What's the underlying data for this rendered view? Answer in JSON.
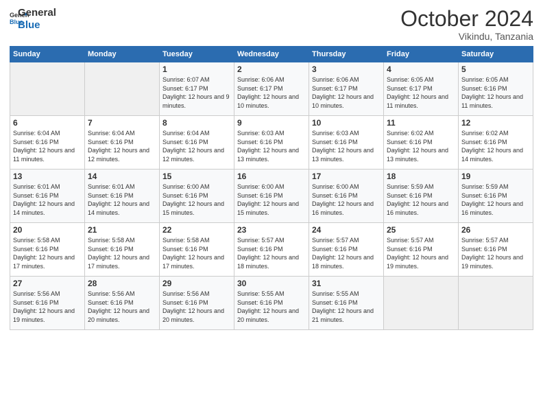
{
  "header": {
    "logo_general": "General",
    "logo_blue": "Blue",
    "month": "October 2024",
    "location": "Vikindu, Tanzania"
  },
  "days_of_week": [
    "Sunday",
    "Monday",
    "Tuesday",
    "Wednesday",
    "Thursday",
    "Friday",
    "Saturday"
  ],
  "weeks": [
    [
      {
        "day": "",
        "sunrise": "",
        "sunset": "",
        "daylight": ""
      },
      {
        "day": "",
        "sunrise": "",
        "sunset": "",
        "daylight": ""
      },
      {
        "day": "1",
        "sunrise": "Sunrise: 6:07 AM",
        "sunset": "Sunset: 6:17 PM",
        "daylight": "Daylight: 12 hours and 9 minutes."
      },
      {
        "day": "2",
        "sunrise": "Sunrise: 6:06 AM",
        "sunset": "Sunset: 6:17 PM",
        "daylight": "Daylight: 12 hours and 10 minutes."
      },
      {
        "day": "3",
        "sunrise": "Sunrise: 6:06 AM",
        "sunset": "Sunset: 6:17 PM",
        "daylight": "Daylight: 12 hours and 10 minutes."
      },
      {
        "day": "4",
        "sunrise": "Sunrise: 6:05 AM",
        "sunset": "Sunset: 6:17 PM",
        "daylight": "Daylight: 12 hours and 11 minutes."
      },
      {
        "day": "5",
        "sunrise": "Sunrise: 6:05 AM",
        "sunset": "Sunset: 6:16 PM",
        "daylight": "Daylight: 12 hours and 11 minutes."
      }
    ],
    [
      {
        "day": "6",
        "sunrise": "Sunrise: 6:04 AM",
        "sunset": "Sunset: 6:16 PM",
        "daylight": "Daylight: 12 hours and 11 minutes."
      },
      {
        "day": "7",
        "sunrise": "Sunrise: 6:04 AM",
        "sunset": "Sunset: 6:16 PM",
        "daylight": "Daylight: 12 hours and 12 minutes."
      },
      {
        "day": "8",
        "sunrise": "Sunrise: 6:04 AM",
        "sunset": "Sunset: 6:16 PM",
        "daylight": "Daylight: 12 hours and 12 minutes."
      },
      {
        "day": "9",
        "sunrise": "Sunrise: 6:03 AM",
        "sunset": "Sunset: 6:16 PM",
        "daylight": "Daylight: 12 hours and 13 minutes."
      },
      {
        "day": "10",
        "sunrise": "Sunrise: 6:03 AM",
        "sunset": "Sunset: 6:16 PM",
        "daylight": "Daylight: 12 hours and 13 minutes."
      },
      {
        "day": "11",
        "sunrise": "Sunrise: 6:02 AM",
        "sunset": "Sunset: 6:16 PM",
        "daylight": "Daylight: 12 hours and 13 minutes."
      },
      {
        "day": "12",
        "sunrise": "Sunrise: 6:02 AM",
        "sunset": "Sunset: 6:16 PM",
        "daylight": "Daylight: 12 hours and 14 minutes."
      }
    ],
    [
      {
        "day": "13",
        "sunrise": "Sunrise: 6:01 AM",
        "sunset": "Sunset: 6:16 PM",
        "daylight": "Daylight: 12 hours and 14 minutes."
      },
      {
        "day": "14",
        "sunrise": "Sunrise: 6:01 AM",
        "sunset": "Sunset: 6:16 PM",
        "daylight": "Daylight: 12 hours and 14 minutes."
      },
      {
        "day": "15",
        "sunrise": "Sunrise: 6:00 AM",
        "sunset": "Sunset: 6:16 PM",
        "daylight": "Daylight: 12 hours and 15 minutes."
      },
      {
        "day": "16",
        "sunrise": "Sunrise: 6:00 AM",
        "sunset": "Sunset: 6:16 PM",
        "daylight": "Daylight: 12 hours and 15 minutes."
      },
      {
        "day": "17",
        "sunrise": "Sunrise: 6:00 AM",
        "sunset": "Sunset: 6:16 PM",
        "daylight": "Daylight: 12 hours and 16 minutes."
      },
      {
        "day": "18",
        "sunrise": "Sunrise: 5:59 AM",
        "sunset": "Sunset: 6:16 PM",
        "daylight": "Daylight: 12 hours and 16 minutes."
      },
      {
        "day": "19",
        "sunrise": "Sunrise: 5:59 AM",
        "sunset": "Sunset: 6:16 PM",
        "daylight": "Daylight: 12 hours and 16 minutes."
      }
    ],
    [
      {
        "day": "20",
        "sunrise": "Sunrise: 5:58 AM",
        "sunset": "Sunset: 6:16 PM",
        "daylight": "Daylight: 12 hours and 17 minutes."
      },
      {
        "day": "21",
        "sunrise": "Sunrise: 5:58 AM",
        "sunset": "Sunset: 6:16 PM",
        "daylight": "Daylight: 12 hours and 17 minutes."
      },
      {
        "day": "22",
        "sunrise": "Sunrise: 5:58 AM",
        "sunset": "Sunset: 6:16 PM",
        "daylight": "Daylight: 12 hours and 17 minutes."
      },
      {
        "day": "23",
        "sunrise": "Sunrise: 5:57 AM",
        "sunset": "Sunset: 6:16 PM",
        "daylight": "Daylight: 12 hours and 18 minutes."
      },
      {
        "day": "24",
        "sunrise": "Sunrise: 5:57 AM",
        "sunset": "Sunset: 6:16 PM",
        "daylight": "Daylight: 12 hours and 18 minutes."
      },
      {
        "day": "25",
        "sunrise": "Sunrise: 5:57 AM",
        "sunset": "Sunset: 6:16 PM",
        "daylight": "Daylight: 12 hours and 19 minutes."
      },
      {
        "day": "26",
        "sunrise": "Sunrise: 5:57 AM",
        "sunset": "Sunset: 6:16 PM",
        "daylight": "Daylight: 12 hours and 19 minutes."
      }
    ],
    [
      {
        "day": "27",
        "sunrise": "Sunrise: 5:56 AM",
        "sunset": "Sunset: 6:16 PM",
        "daylight": "Daylight: 12 hours and 19 minutes."
      },
      {
        "day": "28",
        "sunrise": "Sunrise: 5:56 AM",
        "sunset": "Sunset: 6:16 PM",
        "daylight": "Daylight: 12 hours and 20 minutes."
      },
      {
        "day": "29",
        "sunrise": "Sunrise: 5:56 AM",
        "sunset": "Sunset: 6:16 PM",
        "daylight": "Daylight: 12 hours and 20 minutes."
      },
      {
        "day": "30",
        "sunrise": "Sunrise: 5:55 AM",
        "sunset": "Sunset: 6:16 PM",
        "daylight": "Daylight: 12 hours and 20 minutes."
      },
      {
        "day": "31",
        "sunrise": "Sunrise: 5:55 AM",
        "sunset": "Sunset: 6:16 PM",
        "daylight": "Daylight: 12 hours and 21 minutes."
      },
      {
        "day": "",
        "sunrise": "",
        "sunset": "",
        "daylight": ""
      },
      {
        "day": "",
        "sunrise": "",
        "sunset": "",
        "daylight": ""
      }
    ]
  ]
}
